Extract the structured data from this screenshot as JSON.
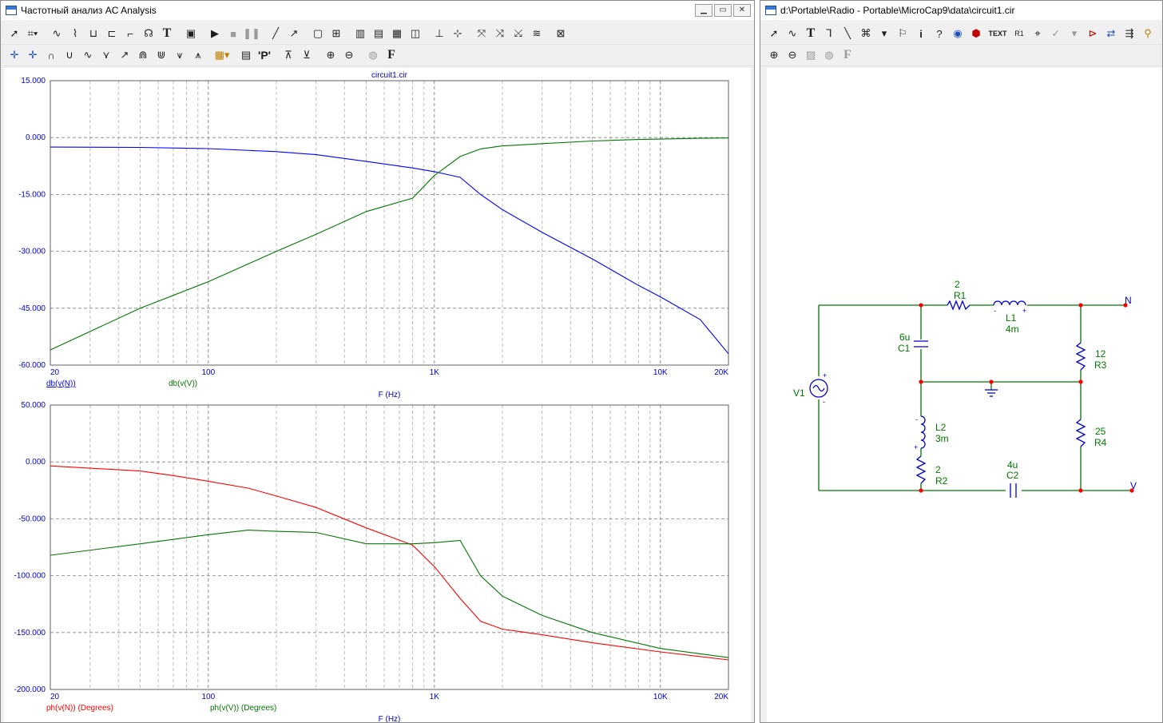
{
  "left_window": {
    "title": "Частотный анализ AC Analysis",
    "buttons": {
      "minimize": "▁",
      "restore": "▭",
      "close": "✕"
    }
  },
  "right_window": {
    "title": "d:\\Portable\\Radio - Portable\\MicroCap9\\data\\circuit1.cir"
  },
  "toolbar_left_row1": [
    "select-arrow-icon",
    "select-dropdown-icon",
    "graph-1-icon",
    "graph-2-icon",
    "graph-3-icon",
    "graph-4-icon",
    "graph-5-icon",
    "graph-6-icon",
    "text-tool-icon",
    "properties-icon",
    "run-icon",
    "stop-icon",
    "pause-icon",
    "line-tool-icon",
    "arrow-tool-icon",
    "frame-1-icon",
    "frame-2-icon",
    "grid-1-icon",
    "grid-2-icon",
    "grid-3-icon",
    "frame-3-icon",
    "axis-icon",
    "cursor-1-icon",
    "cursor-2-icon",
    "cursor-3-icon",
    "cursor-4-icon",
    "cursor-5-icon",
    "chart-icon"
  ],
  "toolbar_left_row2": [
    "peak-icon",
    "valley-icon",
    "high-icon",
    "low-icon",
    "inflection-icon",
    "slope-icon",
    "go-high-icon",
    "go-low-icon",
    "next-icon",
    "prev-icon",
    "tag-icon",
    "table-icon",
    "point-p-icon",
    "scale-1-icon",
    "scale-2-icon",
    "zoom-in-icon",
    "zoom-out-icon",
    "color-icon",
    "font-icon"
  ],
  "toolbar_right_row1": [
    "select-arrow-icon",
    "wire-icon",
    "text-tool-icon",
    "corner-wire-icon",
    "diagonal-wire-icon",
    "component-icon",
    "flag-icon",
    "info-icon",
    "help-icon",
    "globe-icon",
    "stop-sign-icon",
    "text-label-icon",
    "r1-label-icon",
    "pin-icon",
    "node-voltage-icon",
    "probe-icon",
    "step-icon",
    "sweep-icon",
    "bias-icon"
  ],
  "toolbar_right_row2": [
    "zoom-in-icon",
    "zoom-out-icon",
    "grid-icon",
    "color-icon",
    "font-icon"
  ],
  "text_button_label": "TEXT",
  "text_tool_glyph": "T",
  "point_p_glyph": "'P'",
  "font_glyph": "F",
  "chart_data": [
    {
      "type": "line",
      "title": "circuit1.cir",
      "xlabel": "F (Hz)",
      "x_scale": "log",
      "xlim": [
        20,
        20000
      ],
      "ylim": [
        -60,
        15
      ],
      "x_ticks": [
        20,
        100,
        1000,
        10000,
        20000
      ],
      "x_tick_labels": [
        "20",
        "100",
        "1K",
        "10K",
        "20K"
      ],
      "y_ticks": [
        15,
        0,
        -15,
        -30,
        -45,
        -60
      ],
      "y_tick_labels": [
        "15.000",
        "0.000",
        "-15.000",
        "-30.000",
        "-45.000",
        "-60.000"
      ],
      "grid": true,
      "legend_position": "bottom-left",
      "series": [
        {
          "name": "db(v(N))",
          "color": "#0000ff",
          "x": [
            20,
            50,
            100,
            200,
            300,
            500,
            800,
            1000,
            1300,
            1600,
            2000,
            3000,
            5000,
            8000,
            10000,
            15000,
            20000
          ],
          "y": [
            -2.5,
            -2.6,
            -2.9,
            -3.7,
            -4.5,
            -6.3,
            -8,
            -9,
            -10.5,
            -15,
            -19,
            -25,
            -32,
            -39,
            -42,
            -48,
            -57
          ]
        },
        {
          "name": "db(v(V))",
          "color": "#007700",
          "x": [
            20,
            50,
            100,
            200,
            300,
            500,
            800,
            1000,
            1300,
            1600,
            2000,
            3000,
            5000,
            8000,
            10000,
            15000,
            20000
          ],
          "y": [
            -56,
            -45,
            -38,
            -30,
            -25.5,
            -19.5,
            -16,
            -10,
            -5,
            -3,
            -2.2,
            -1.6,
            -0.9,
            -0.5,
            -0.4,
            -0.2,
            -0.1
          ]
        }
      ]
    },
    {
      "type": "line",
      "xlabel": "F (Hz)",
      "x_scale": "log",
      "xlim": [
        20,
        20000
      ],
      "ylim": [
        -200,
        50
      ],
      "x_ticks": [
        20,
        100,
        1000,
        10000,
        20000
      ],
      "x_tick_labels": [
        "20",
        "100",
        "1K",
        "10K",
        "20K"
      ],
      "y_ticks": [
        50,
        0,
        -50,
        -100,
        -150,
        -200
      ],
      "y_tick_labels": [
        "50.000",
        "0.000",
        "-50.000",
        "-100.000",
        "-150.000",
        "-200.000"
      ],
      "grid": true,
      "legend_position": "bottom-left",
      "series": [
        {
          "name": "ph(v(N)) (Degrees)",
          "color": "#ff0000",
          "x": [
            20,
            50,
            70,
            100,
            150,
            200,
            300,
            500,
            800,
            1000,
            1300,
            1600,
            2000,
            3000,
            5000,
            10000,
            20000
          ],
          "y": [
            -3.5,
            -8,
            -12,
            -17,
            -23,
            -30,
            -40,
            -58,
            -73,
            -92,
            -120,
            -140,
            -147,
            -152,
            -159,
            -167,
            -174
          ]
        },
        {
          "name": "ph(v(V)) (Degrees)",
          "color": "#007700",
          "x": [
            20,
            50,
            100,
            150,
            200,
            300,
            500,
            800,
            1000,
            1300,
            1600,
            2000,
            3000,
            5000,
            10000,
            20000
          ],
          "y": [
            -82,
            -72,
            -64,
            -60,
            -61,
            -62,
            -72,
            -72,
            -71,
            -69,
            -100,
            -118,
            -135,
            -150,
            -164,
            -172
          ]
        }
      ]
    }
  ],
  "schematic": {
    "components": [
      {
        "ref": "R1",
        "value": "2"
      },
      {
        "ref": "L1",
        "value": "4m"
      },
      {
        "ref": "C1",
        "value": "6u"
      },
      {
        "ref": "R3",
        "value": "12"
      },
      {
        "ref": "L2",
        "value": "3m"
      },
      {
        "ref": "R2",
        "value": "2"
      },
      {
        "ref": "C2",
        "value": "4u"
      },
      {
        "ref": "R4",
        "value": "25"
      },
      {
        "ref": "V1",
        "value": ""
      }
    ],
    "nodes": [
      "N",
      "V"
    ],
    "colors": {
      "wire": "#007700",
      "component": "#0000cc",
      "label": "#007700",
      "junction": "#ff0000"
    }
  }
}
